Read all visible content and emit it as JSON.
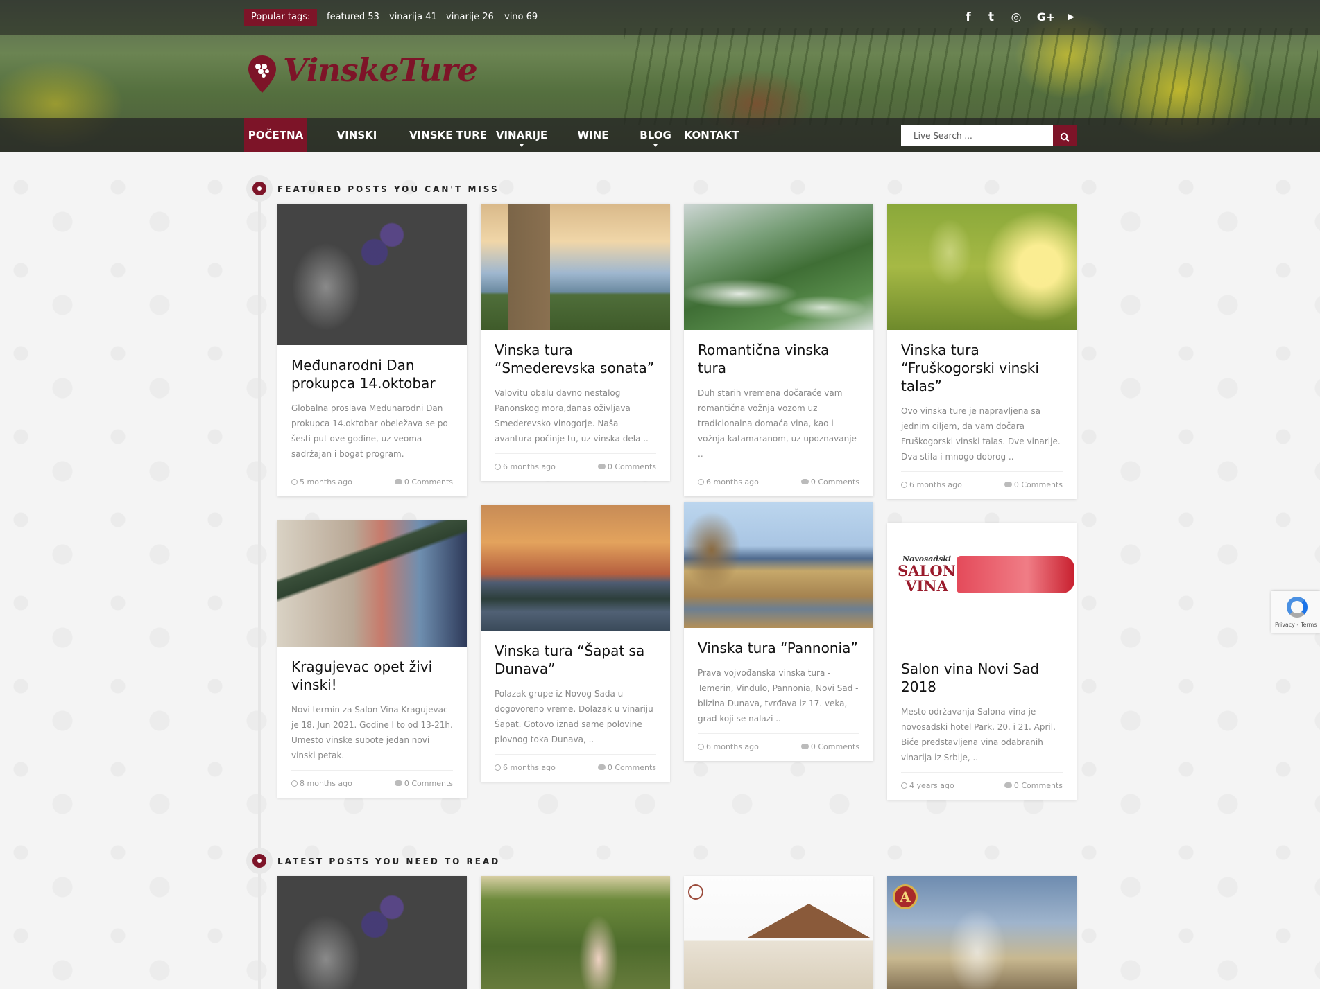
{
  "topbar": {
    "tags_label": "Popular tags:",
    "tags": [
      {
        "label": "featured 53"
      },
      {
        "label": "vinarija 41"
      },
      {
        "label": "vinarije 26"
      },
      {
        "label": "vino 69"
      }
    ],
    "social": [
      {
        "name": "facebook-icon",
        "glyph": "f"
      },
      {
        "name": "twitter-icon",
        "glyph": "t"
      },
      {
        "name": "instagram-icon",
        "glyph": "◎"
      },
      {
        "name": "google-plus-icon",
        "glyph": "G+"
      },
      {
        "name": "youtube-icon",
        "glyph": "▶"
      }
    ]
  },
  "brand": {
    "logo_text": "VinskeTure",
    "accent_color": "#7d1428"
  },
  "nav": {
    "items": [
      {
        "label": "POČETNA",
        "active": true
      },
      {
        "label": "VINSKI REGIONI"
      },
      {
        "label": "VINSKE TURE"
      },
      {
        "label": "VINARIJE",
        "dropdown": true
      },
      {
        "label": "WINE EVENT"
      },
      {
        "label": "BLOG",
        "dropdown": true
      },
      {
        "label": "KONTAKT"
      }
    ],
    "search_placeholder": "Live Search ..."
  },
  "featured": {
    "title": "FEATURED POSTS YOU CAN'T MISS",
    "posts": [
      {
        "title": "Međunarodni Dan prokupca 14.oktobar",
        "excerpt": "Globalna proslava Međunarodni Dan prokupca 14.oktobar obeležava se po šesti put ove godine, uz veoma sadržajan i bogat program.",
        "time": "5 months ago",
        "comments": "0 Comments",
        "image": "grapes-hands-image"
      },
      {
        "title": "Vinska tura “Smederevska sonata”",
        "excerpt": "Valovitu obalu davno nestalog Panonskog mora,danas oživljava Smederevsko vinogorje. Naša avantura počinje tu, uz vinska dela ..",
        "time": "6 months ago",
        "comments": "0 Comments",
        "image": "fortress-image"
      },
      {
        "title": "Romantična vinska tura",
        "excerpt": "Duh starih vremena dočaraće vam romantična vožnja vozom uz tradicionalna domaća vina, kao i vožnja katamaranom, uz upoznavanje ..",
        "time": "6 months ago",
        "comments": "0 Comments",
        "image": "river-image"
      },
      {
        "title": "Vinska tura “Fruškogorski vinski talas”",
        "excerpt": "Ovo vinska ture je napravljena sa jednim ciljem, da vam dočara Fruškogorski vinski talas. Dve vinarije. Dva stila i mnogo dobrog ..",
        "time": "6 months ago",
        "comments": "0 Comments",
        "image": "green-grapes-image"
      },
      {
        "title": "Kragujevac opet živi vinski!",
        "excerpt": "Novi termin za Salon Vina Kragujevac je 18. Jun 2021. Godine I to od 13-21h. Umesto vinske subote jedan novi vinski petak.",
        "time": "8 months ago",
        "comments": "0 Comments",
        "image": "wine-pour-image"
      },
      {
        "title": "Vinska tura “Šapat sa Dunava”",
        "excerpt": "Polazak grupe iz Novog Sada u dogovoreno vreme.   Dolazak u vinariju Šapat. Gotovo iznad same polovine plovnog toka Dunava, ..",
        "time": "6 months ago",
        "comments": "0 Comments",
        "image": "sunset-image"
      },
      {
        "title": "Vinska tura “Pannonia”",
        "excerpt": "Prava vojvođanska vinska tura - Temerin, Vindulo, Pannonia, Novi Sad - blizina Dunava, tvrđava iz 17. veka, grad koji se nalazi ..",
        "time": "6 months ago",
        "comments": "0 Comments",
        "image": "lake-image"
      },
      {
        "title": "Salon vina Novi Sad 2018",
        "excerpt": "Mesto održavanja Salona vina je novosadski hotel Park, 20. i 21. April. Biće predstavljena vina odabranih vinarija iz Srbije, ..",
        "time": "4 years ago",
        "comments": "0 Comments",
        "image": "salon-vina-image",
        "image_text": [
          "Novosadski",
          "SALON",
          "VINA"
        ]
      }
    ]
  },
  "latest": {
    "title": "LATEST POSTS YOU NEED TO READ",
    "emblem_letter": "A"
  },
  "recaptcha": {
    "text": "Privacy - Terms"
  }
}
